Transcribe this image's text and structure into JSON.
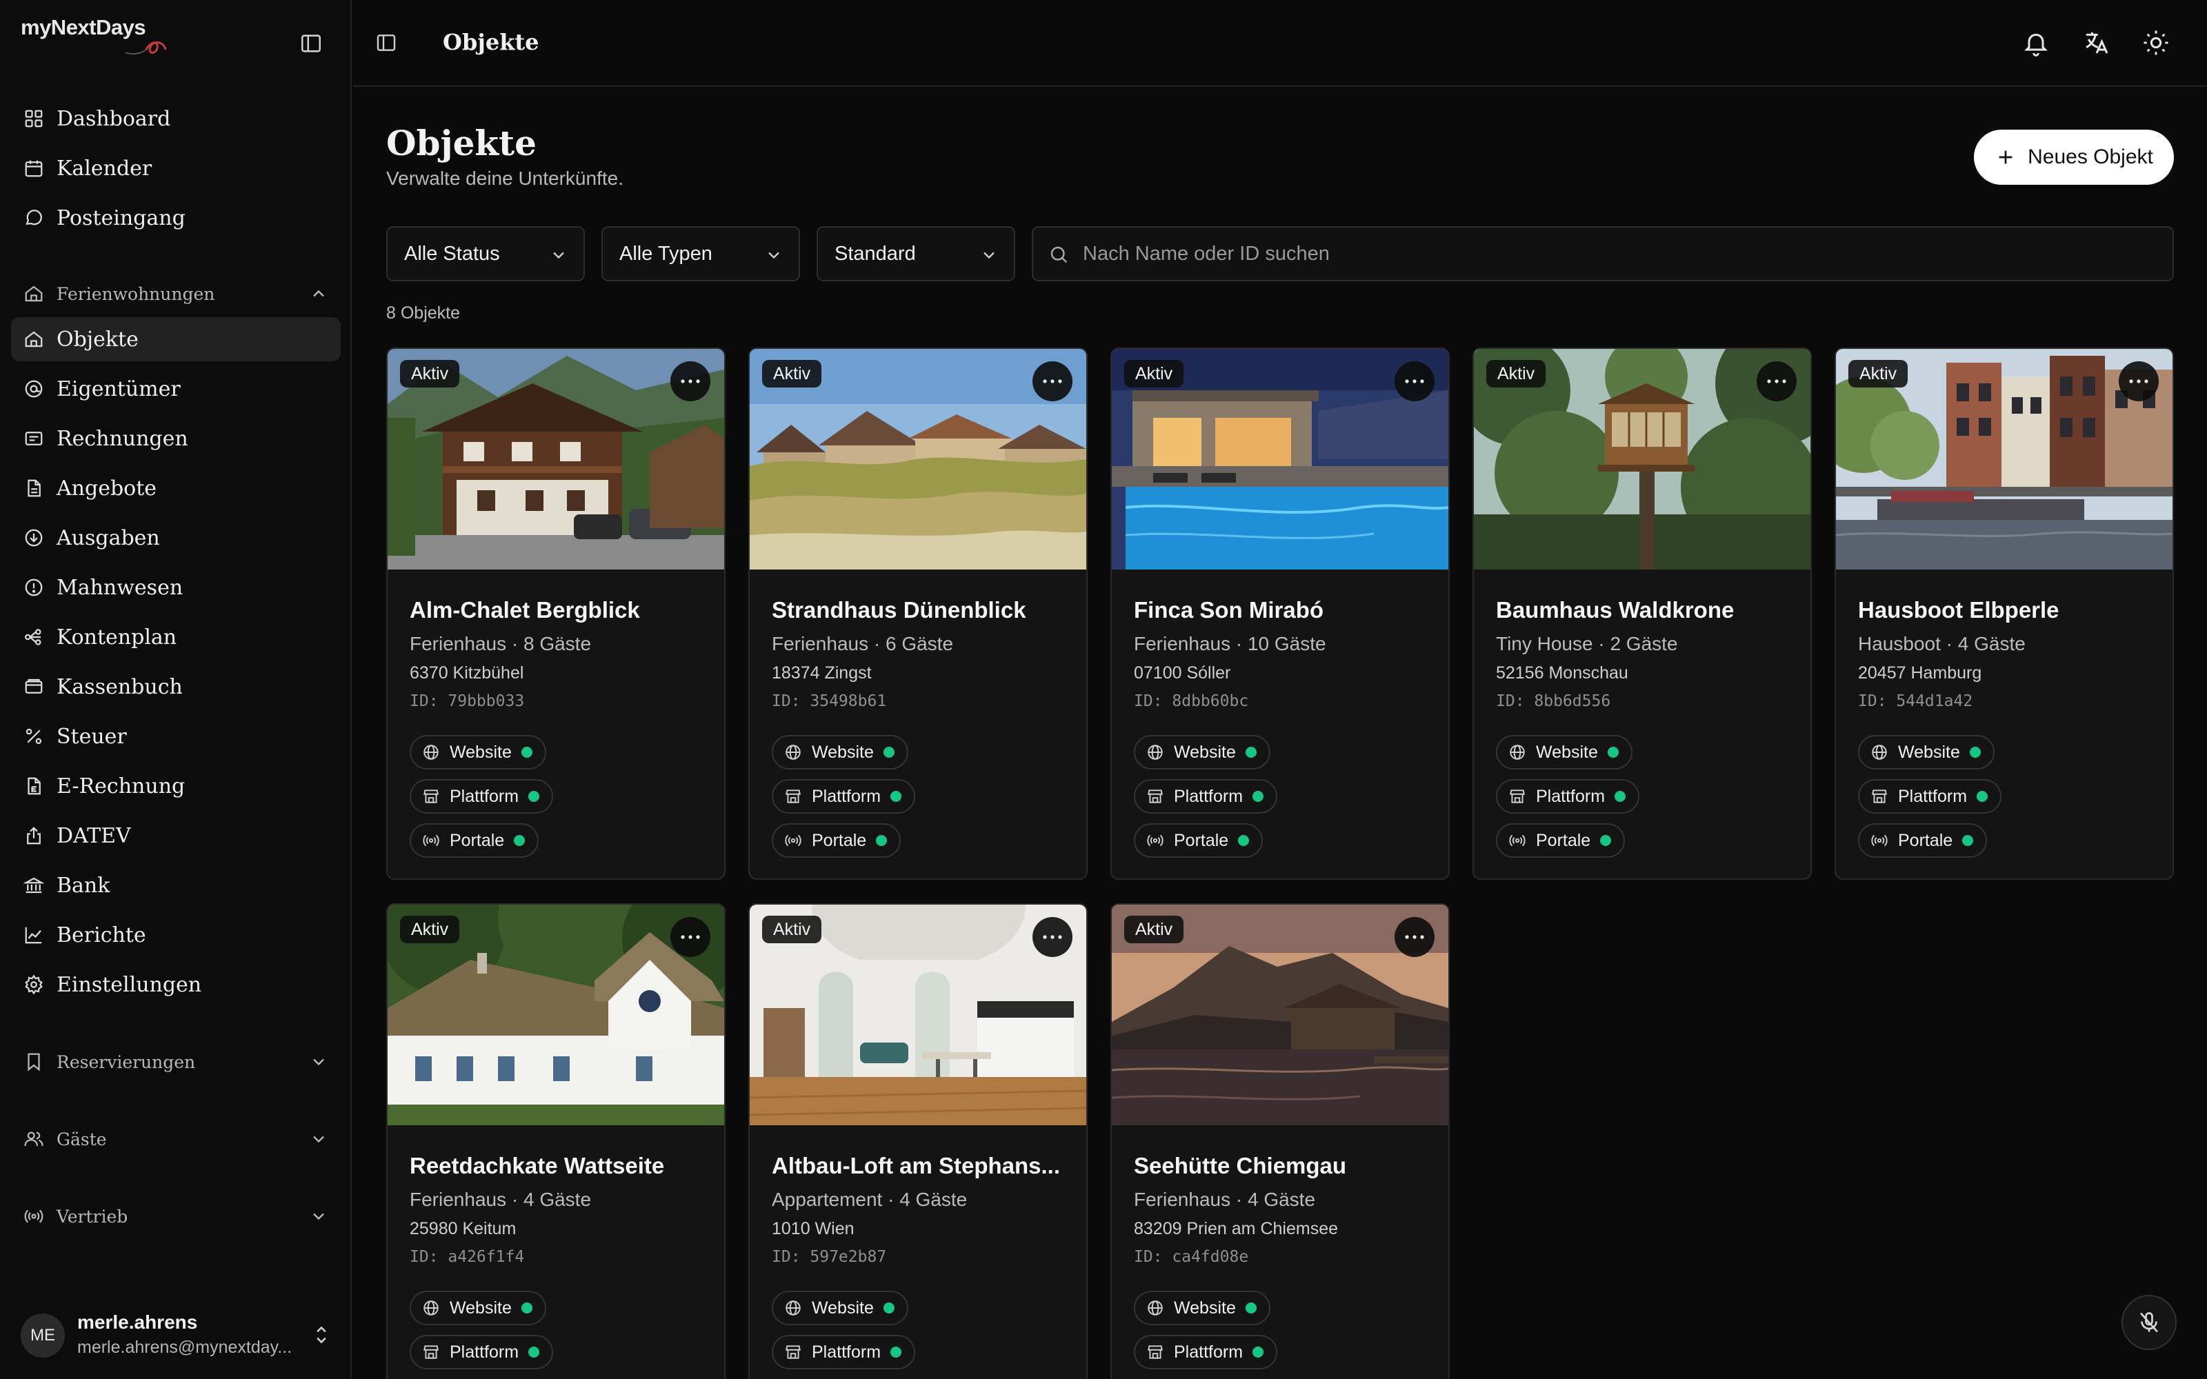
{
  "app": {
    "logo": "myNextDays"
  },
  "topbar": {
    "title": "Objekte"
  },
  "nav": {
    "main": [
      {
        "label": "Dashboard",
        "icon": "grid-icon"
      },
      {
        "label": "Kalender",
        "icon": "calendar-icon"
      },
      {
        "label": "Posteingang",
        "icon": "chat-icon"
      }
    ],
    "section_ferien": "Ferienwohnungen",
    "ferien": [
      {
        "label": "Objekte",
        "icon": "house-icon",
        "active": true
      },
      {
        "label": "Eigentümer",
        "icon": "owner-icon"
      },
      {
        "label": "Rechnungen",
        "icon": "invoice-icon"
      },
      {
        "label": "Angebote",
        "icon": "offer-icon"
      },
      {
        "label": "Ausgaben",
        "icon": "expense-icon"
      },
      {
        "label": "Mahnwesen",
        "icon": "alert-icon"
      },
      {
        "label": "Kontenplan",
        "icon": "accounts-icon"
      },
      {
        "label": "Kassenbuch",
        "icon": "cashbook-icon"
      },
      {
        "label": "Steuer",
        "icon": "percent-icon"
      },
      {
        "label": "E-Rechnung",
        "icon": "e-invoice-icon"
      },
      {
        "label": "DATEV",
        "icon": "upload-icon"
      },
      {
        "label": "Bank",
        "icon": "bank-icon"
      },
      {
        "label": "Berichte",
        "icon": "chart-icon"
      },
      {
        "label": "Einstellungen",
        "icon": "gear-icon"
      }
    ],
    "section_reserv": "Reservierungen",
    "section_gaeste": "Gäste",
    "section_vertrieb": "Vertrieb"
  },
  "user": {
    "initials": "ME",
    "name": "merle.ahrens",
    "email": "merle.ahrens@mynextday..."
  },
  "main": {
    "title": "Objekte",
    "subtitle": "Verwalte deine Unterkünfte.",
    "new_button": "Neues Objekt",
    "filters": {
      "status": "Alle Status",
      "types": "Alle Typen",
      "sort": "Standard"
    },
    "search_placeholder": "Nach Name oder ID suchen",
    "count": "8 Objekte",
    "channels": {
      "website": "Website",
      "platform": "Plattform",
      "portals": "Portale"
    }
  },
  "colors": {
    "accent_dot": "#16c784",
    "background": "#0a0a0a",
    "card": "#141414"
  },
  "properties": [
    {
      "name": "Alm-Chalet Bergblick",
      "type": "Ferienhaus · 8 Gäste",
      "address": "6370 Kitzbühel",
      "id": "ID: 79bbb033",
      "status": "Aktiv"
    },
    {
      "name": "Strandhaus Dünenblick",
      "type": "Ferienhaus · 6 Gäste",
      "address": "18374 Zingst",
      "id": "ID: 35498b61",
      "status": "Aktiv"
    },
    {
      "name": "Finca Son Mirabó",
      "type": "Ferienhaus · 10 Gäste",
      "address": "07100 Sóller",
      "id": "ID: 8dbb60bc",
      "status": "Aktiv"
    },
    {
      "name": "Baumhaus Waldkrone",
      "type": "Tiny House · 2 Gäste",
      "address": "52156 Monschau",
      "id": "ID: 8bb6d556",
      "status": "Aktiv"
    },
    {
      "name": "Hausboot Elbperle",
      "type": "Hausboot · 4 Gäste",
      "address": "20457 Hamburg",
      "id": "ID: 544d1a42",
      "status": "Aktiv"
    },
    {
      "name": "Reetdachkate Wattseite",
      "type": "Ferienhaus · 4 Gäste",
      "address": "25980 Keitum",
      "id": "ID: a426f1f4",
      "status": "Aktiv"
    },
    {
      "name": "Altbau-Loft am Stephans...",
      "type": "Appartement · 4 Gäste",
      "address": "1010 Wien",
      "id": "ID: 597e2b87",
      "status": "Aktiv"
    },
    {
      "name": "Seehütte Chiemgau",
      "type": "Ferienhaus · 4 Gäste",
      "address": "83209 Prien am Chiemsee",
      "id": "ID: ca4fd08e",
      "status": "Aktiv"
    }
  ]
}
